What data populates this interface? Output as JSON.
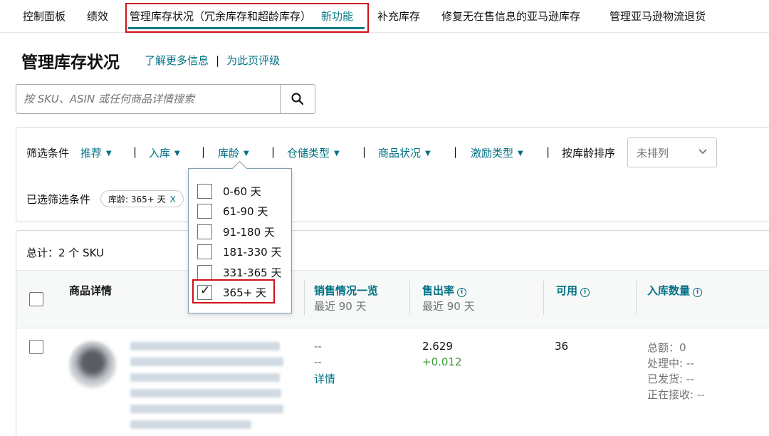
{
  "nav": {
    "items": [
      "控制面板",
      "绩效",
      "管理库存状况（冗余库存和超龄库存）",
      "补充库存",
      "修复无在售信息的亚马逊库存",
      "管理亚马逊物流退货"
    ],
    "new_badge": "新功能"
  },
  "header": {
    "title": "管理库存状况",
    "link_learn": "了解更多信息",
    "separator": "|",
    "link_rate": "为此页评级"
  },
  "search": {
    "placeholder": "按 SKU、ASIN 或任何商品详情搜索"
  },
  "filters": {
    "label": "筛选条件",
    "items": [
      "推荐",
      "入库",
      "库龄",
      "仓储类型",
      "商品状况",
      "激励类型"
    ],
    "sort_label": "按库龄排序",
    "sort_value": "未排列",
    "selected_label": "已选筛选条件",
    "chip_text": "库龄: 365+ 天",
    "chip_remove": "X"
  },
  "age_dropdown": {
    "options": [
      {
        "label": "0-60 天",
        "checked": false
      },
      {
        "label": "61-90 天",
        "checked": false
      },
      {
        "label": "91-180 天",
        "checked": false
      },
      {
        "label": "181-330 天",
        "checked": false
      },
      {
        "label": "331-365 天",
        "checked": false
      },
      {
        "label": "365+ 天",
        "checked": true
      }
    ]
  },
  "table": {
    "total": "总计：2 个 SKU",
    "headers": {
      "product": "商品详情",
      "sales": "销售情况一览",
      "sales_sub": "最近 90 天",
      "sellthrough": "售出率",
      "sellthrough_sub": "最近 90 天",
      "available": "可用",
      "inbound": "入库数量"
    },
    "row": {
      "sales_1": "--",
      "sales_2": "--",
      "sales_link": "详情",
      "sellthrough": "2.629",
      "sellthrough_delta": "+0.012",
      "available": "36",
      "inbound_total": "总额：0",
      "inbound_processing": "处理中: --",
      "inbound_shipped": "已发货: --",
      "inbound_receiving": "正在接收: --"
    }
  },
  "colors": {
    "accent": "#007185",
    "underline": "#0a7e8c",
    "highlight": "#d0111b",
    "positive": "#3a9a3a"
  }
}
